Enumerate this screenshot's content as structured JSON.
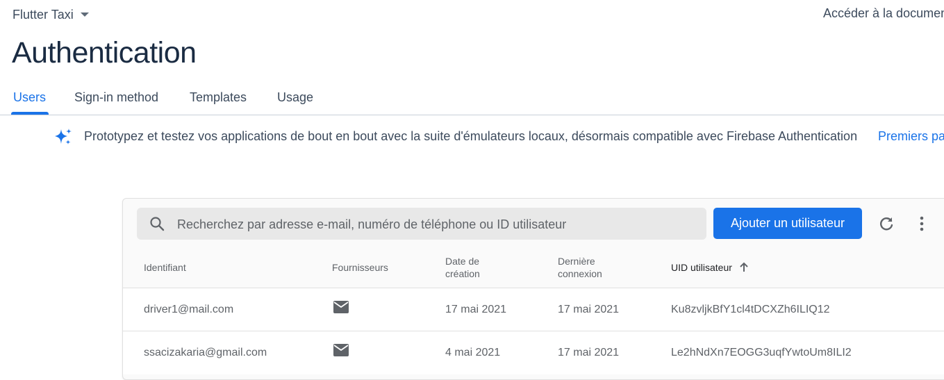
{
  "header": {
    "project_name": "Flutter Taxi",
    "doc_link": "Accéder à la documentation",
    "page_title": "Authentication"
  },
  "tabs": [
    {
      "label": "Users",
      "active": true
    },
    {
      "label": "Sign-in method",
      "active": false
    },
    {
      "label": "Templates",
      "active": false
    },
    {
      "label": "Usage",
      "active": false
    }
  ],
  "banner": {
    "icon": "sparkle-icon",
    "text": "Prototypez et testez vos applications de bout en bout avec la suite d'émulateurs locaux, désormais compatible avec Firebase Authentication",
    "link": "Premiers pas"
  },
  "toolbar": {
    "search_placeholder": "Recherchez par adresse e-mail, numéro de téléphone ou ID utilisateur",
    "add_user_label": "Ajouter un utilisateur"
  },
  "table": {
    "columns": {
      "identifier": "Identifiant",
      "providers": "Fournisseurs",
      "created_line1": "Date de",
      "created_line2": "création",
      "last_login_line1": "Dernière",
      "last_login_line2": "connexion",
      "uid": "UID utilisateur"
    },
    "sort": {
      "column": "uid",
      "direction": "ascending"
    },
    "rows": [
      {
        "identifier": "driver1@mail.com",
        "provider": "email-icon",
        "created": "17 mai 2021",
        "last_login": "17 mai 2021",
        "uid": "Ku8zvljkBfY1cl4tDCXZh6ILIQ12"
      },
      {
        "identifier": "ssacizakaria@gmail.com",
        "provider": "email-icon",
        "created": "4 mai 2021",
        "last_login": "17 mai 2021",
        "uid": "Le2hNdXn7EOGG3uqfYwtoUm8ILI2"
      }
    ]
  },
  "colors": {
    "accent": "#1a73e8",
    "text": "#3c4a5c",
    "title": "#1a2b42"
  }
}
